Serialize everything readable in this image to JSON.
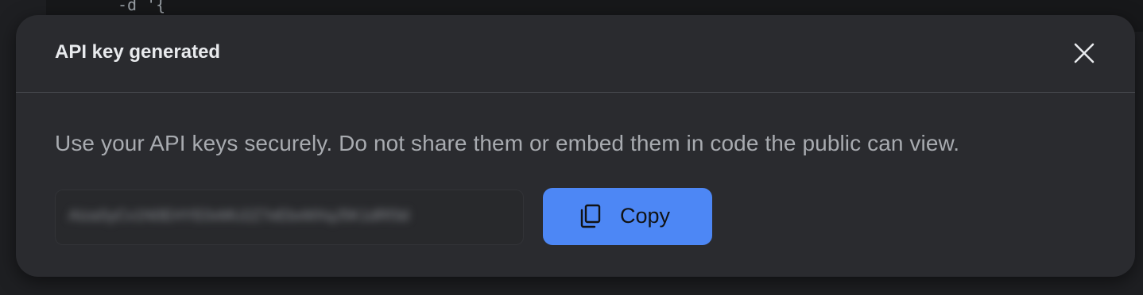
{
  "background": {
    "code_snippet": "-d '{"
  },
  "dialog": {
    "title": "API key generated",
    "close_icon": "close-icon",
    "message": "Use your API keys securely. Do not share them or embed them in code the public can view.",
    "api_key_masked": "AIzaSyCv1N0EHYE0xMU2Z7eEbxMXqJ5K1dRf3d",
    "copy_button": {
      "label": "Copy",
      "icon": "copy-icon"
    }
  },
  "colors": {
    "accent": "#4d87f5",
    "dialog_bg": "#2a2b2f",
    "page_bg": "#1e1f22"
  }
}
